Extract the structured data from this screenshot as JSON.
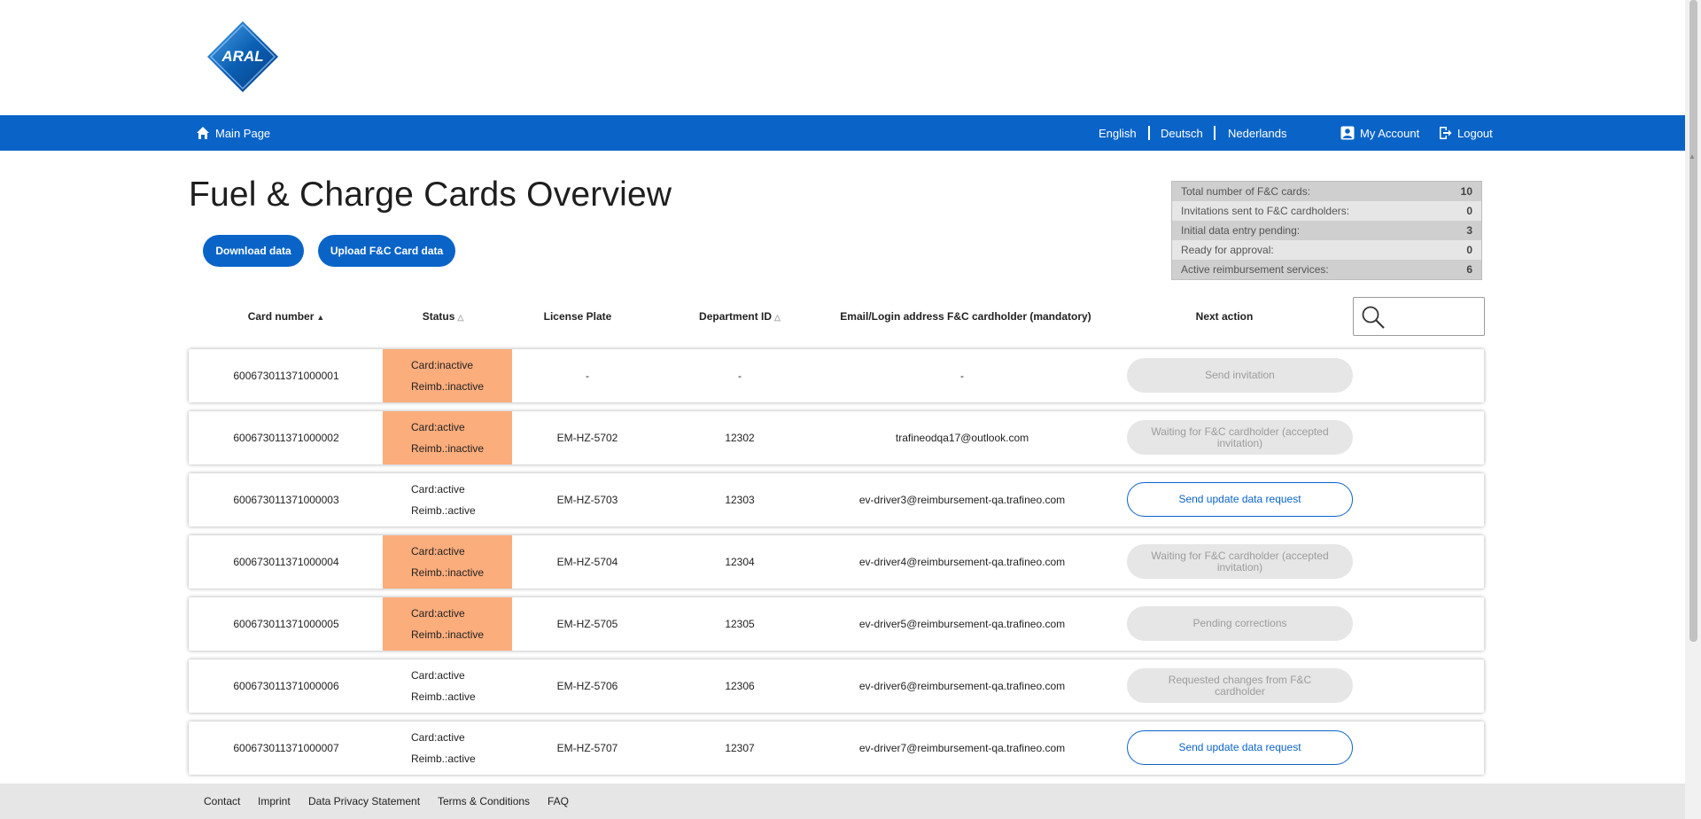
{
  "logo": {
    "text": "ARAL"
  },
  "nav": {
    "main_page": "Main Page",
    "languages": [
      "English",
      "Deutsch",
      "Nederlands"
    ],
    "my_account": "My Account",
    "logout": "Logout"
  },
  "page": {
    "title": "Fuel & Charge Cards Overview",
    "download_btn": "Download data",
    "upload_btn": "Upload F&C Card data"
  },
  "stats": [
    {
      "label": "Total number of F&C cards:",
      "value": "10"
    },
    {
      "label": "Invitations sent to F&C cardholders:",
      "value": "0"
    },
    {
      "label": "Initial data entry pending:",
      "value": "3"
    },
    {
      "label": "Ready for approval:",
      "value": "0"
    },
    {
      "label": "Active reimbursement services:",
      "value": "6"
    }
  ],
  "table": {
    "headers": {
      "card_number": "Card number",
      "status": "Status",
      "license_plate": "License Plate",
      "department_id": "Department ID",
      "email": "Email/Login address F&C cardholder (mandatory)",
      "next_action": "Next action"
    },
    "sort_icons": {
      "asc": "▲",
      "none": "△"
    },
    "rows": [
      {
        "card": "600673011371000001",
        "card_status": "Card:inactive",
        "reimb_status": "Reimb.:inactive",
        "warn": true,
        "plate": "-",
        "dept": "-",
        "email": "-",
        "action": "Send invitation",
        "action_state": "disabled"
      },
      {
        "card": "600673011371000002",
        "card_status": "Card:active",
        "reimb_status": "Reimb.:inactive",
        "warn": true,
        "plate": "EM-HZ-5702",
        "dept": "12302",
        "email": "trafineodqa17@outlook.com",
        "action": "Waiting for F&C cardholder (accepted invitation)",
        "action_state": "disabled"
      },
      {
        "card": "600673011371000003",
        "card_status": "Card:active",
        "reimb_status": "Reimb.:active",
        "warn": false,
        "plate": "EM-HZ-5703",
        "dept": "12303",
        "email": "ev-driver3@reimbursement-qa.trafineo.com",
        "action": "Send update data request",
        "action_state": "active"
      },
      {
        "card": "600673011371000004",
        "card_status": "Card:active",
        "reimb_status": "Reimb.:inactive",
        "warn": true,
        "plate": "EM-HZ-5704",
        "dept": "12304",
        "email": "ev-driver4@reimbursement-qa.trafineo.com",
        "action": "Waiting for F&C cardholder (accepted invitation)",
        "action_state": "disabled"
      },
      {
        "card": "600673011371000005",
        "card_status": "Card:active",
        "reimb_status": "Reimb.:inactive",
        "warn": true,
        "plate": "EM-HZ-5705",
        "dept": "12305",
        "email": "ev-driver5@reimbursement-qa.trafineo.com",
        "action": "Pending corrections",
        "action_state": "disabled"
      },
      {
        "card": "600673011371000006",
        "card_status": "Card:active",
        "reimb_status": "Reimb.:active",
        "warn": false,
        "plate": "EM-HZ-5706",
        "dept": "12306",
        "email": "ev-driver6@reimbursement-qa.trafineo.com",
        "action": "Requested changes from F&C cardholder",
        "action_state": "disabled"
      },
      {
        "card": "600673011371000007",
        "card_status": "Card:active",
        "reimb_status": "Reimb.:active",
        "warn": false,
        "plate": "EM-HZ-5707",
        "dept": "12307",
        "email": "ev-driver7@reimbursement-qa.trafineo.com",
        "action": "Send update data request",
        "action_state": "active"
      }
    ]
  },
  "footer": {
    "links": [
      "Contact",
      "Imprint",
      "Data Privacy Statement",
      "Terms & Conditions",
      "FAQ"
    ]
  },
  "colors": {
    "brand_blue": "#0a64c8",
    "status_warning": "#fcad7c",
    "disabled_button": "#e6e6e6"
  }
}
